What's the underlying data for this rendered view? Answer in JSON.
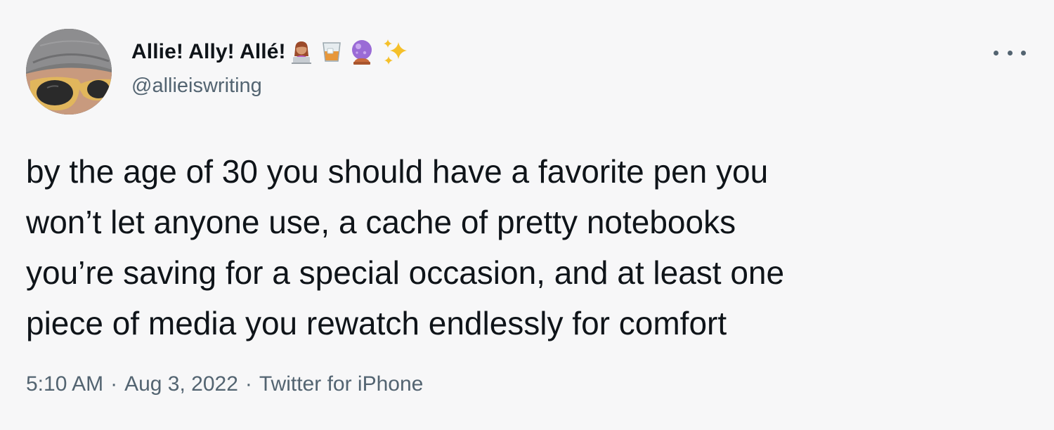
{
  "author": {
    "display_name": "Allie! Ally! Allé!",
    "handle": "@allieiswriting",
    "name_emojis": [
      "woman-technologist-icon",
      "tumbler-glass-icon",
      "crystal-ball-icon",
      "sparkles-icon"
    ]
  },
  "tweet": {
    "text": "by the age of 30 you should have a favorite pen you\nwon’t let anyone use, a cache of pretty notebooks\nyou’re saving for a special occasion, and at least one\npiece of media you rewatch endlessly for comfort"
  },
  "meta": {
    "time": "5:10 AM",
    "separator": "·",
    "date": "Aug 3, 2022",
    "source": "Twitter for iPhone"
  },
  "icons": {
    "more": "more-horizontal-icon"
  },
  "colors": {
    "background": "#f7f7f8",
    "text": "#0f1419",
    "secondary": "#536471"
  }
}
